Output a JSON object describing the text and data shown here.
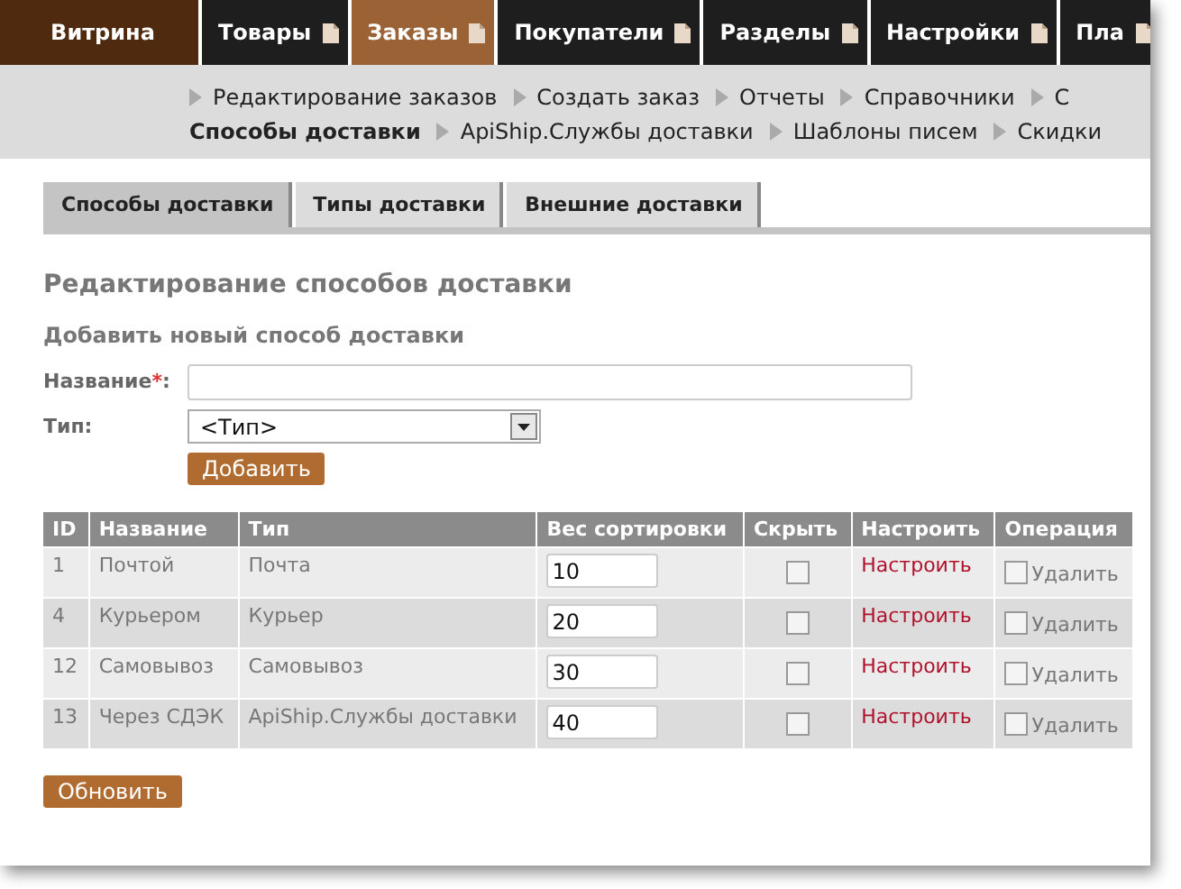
{
  "top_menu": [
    {
      "label": "Витрина",
      "kind": "home",
      "selected": false
    },
    {
      "label": "Товары",
      "kind": "section",
      "selected": false
    },
    {
      "label": "Заказы",
      "kind": "section",
      "selected": true
    },
    {
      "label": "Покупатели",
      "kind": "section",
      "selected": false
    },
    {
      "label": "Разделы",
      "kind": "section",
      "selected": false
    },
    {
      "label": "Настройки",
      "kind": "section",
      "selected": false
    },
    {
      "label": "Пла",
      "kind": "section",
      "selected": false
    }
  ],
  "submenu_rows": [
    [
      {
        "label": "Редактирование заказов",
        "selected": false
      },
      {
        "label": "Создать заказ",
        "selected": false
      },
      {
        "label": "Отчеты",
        "selected": false
      },
      {
        "label": "Справочники",
        "selected": false
      },
      {
        "label": "С",
        "selected": false
      }
    ],
    [
      {
        "label": "Способы доставки",
        "selected": true
      },
      {
        "label": "ApiShip.Службы доставки",
        "selected": false
      },
      {
        "label": "Шаблоны писем",
        "selected": false
      },
      {
        "label": "Скидки",
        "selected": false
      }
    ]
  ],
  "tabs": [
    {
      "label": "Способы доставки",
      "selected": true
    },
    {
      "label": "Типы доставки",
      "selected": false
    },
    {
      "label": "Внешние доставки",
      "selected": false
    }
  ],
  "heading": "Редактирование способов доставки",
  "subheading": "Добавить новый способ доставки",
  "form": {
    "name_label": "Название",
    "required_mark": "*",
    "name_suffix": ":",
    "type_label": "Тип:",
    "type_value": "<Тип>",
    "add_button": "Добавить"
  },
  "table": {
    "columns": [
      "ID",
      "Название",
      "Тип",
      "Вес сортировки",
      "Скрыть",
      "Настроить",
      "Операция"
    ],
    "rows": [
      {
        "id": "1",
        "name": "Почтой",
        "type": "Почта",
        "sort_weight": "10",
        "hidden": false,
        "configure": "Настроить",
        "delete_checked": false,
        "delete_label": "Удалить"
      },
      {
        "id": "4",
        "name": "Курьером",
        "type": "Курьер",
        "sort_weight": "20",
        "hidden": false,
        "configure": "Настроить",
        "delete_checked": false,
        "delete_label": "Удалить"
      },
      {
        "id": "12",
        "name": "Самовывоз",
        "type": "Самовывоз",
        "sort_weight": "30",
        "hidden": false,
        "configure": "Настроить",
        "delete_checked": false,
        "delete_label": "Удалить"
      },
      {
        "id": "13",
        "name": "Через СДЭК",
        "type": "ApiShip.Службы доставки",
        "sort_weight": "40",
        "hidden": false,
        "configure": "Настроить",
        "delete_checked": false,
        "delete_label": "Удалить"
      }
    ]
  },
  "update_button": "Обновить"
}
